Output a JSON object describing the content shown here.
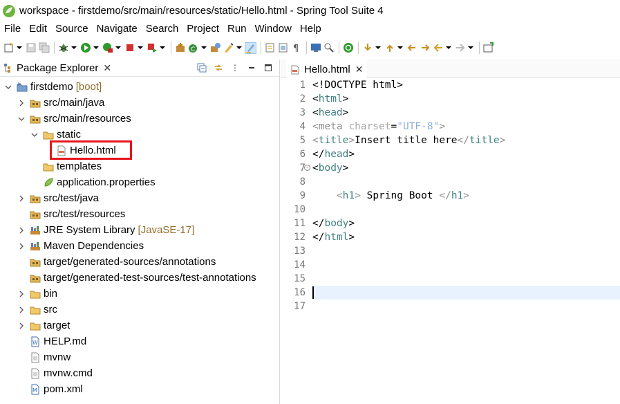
{
  "window": {
    "title": "workspace - firstdemo/src/main/resources/static/Hello.html - Spring Tool Suite 4"
  },
  "menu": [
    "File",
    "Edit",
    "Source",
    "Navigate",
    "Search",
    "Project",
    "Run",
    "Window",
    "Help"
  ],
  "package_explorer": {
    "tab_label": "Package Explorer",
    "tree": [
      {
        "label": "firstdemo",
        "deco": "[boot]",
        "icon": "project-icon",
        "expanded": true
      },
      {
        "label": "src/main/java",
        "icon": "source-folder-icon",
        "expanded": false
      },
      {
        "label": "src/main/resources",
        "icon": "source-folder-icon",
        "expanded": true
      },
      {
        "label": "static",
        "icon": "folder-icon",
        "expanded": true
      },
      {
        "label": "Hello.html",
        "icon": "html-file-icon",
        "highlighted": true
      },
      {
        "label": "templates",
        "icon": "folder-icon"
      },
      {
        "label": "application.properties",
        "icon": "properties-file-icon"
      },
      {
        "label": "src/test/java",
        "icon": "source-folder-icon",
        "expanded": false
      },
      {
        "label": "src/test/resources",
        "icon": "source-folder-icon"
      },
      {
        "label": "JRE System Library",
        "deco": "[JavaSE-17]",
        "icon": "library-icon",
        "expanded": false
      },
      {
        "label": "Maven Dependencies",
        "icon": "library-icon",
        "expanded": false
      },
      {
        "label": "target/generated-sources/annotations",
        "icon": "source-folder-icon"
      },
      {
        "label": "target/generated-test-sources/test-annotations",
        "icon": "source-folder-icon"
      },
      {
        "label": "bin",
        "icon": "folder-icon",
        "expanded": false
      },
      {
        "label": "src",
        "icon": "folder-icon",
        "expanded": false
      },
      {
        "label": "target",
        "icon": "folder-icon",
        "expanded": false
      },
      {
        "label": "HELP.md",
        "icon": "text-file-icon"
      },
      {
        "label": "mvnw",
        "icon": "file-icon"
      },
      {
        "label": "mvnw.cmd",
        "icon": "file-icon"
      },
      {
        "label": "pom.xml",
        "icon": "xml-file-icon"
      }
    ]
  },
  "editor": {
    "tab_label": "Hello.html",
    "current_line": 16,
    "lines": [
      [
        [
          "black",
          "<!DOCTYPE html>"
        ]
      ],
      [
        [
          "black",
          "<"
        ],
        [
          "tag",
          "html"
        ],
        [
          "black",
          ">"
        ]
      ],
      [
        [
          "black",
          "<"
        ],
        [
          "tag",
          "head"
        ],
        [
          "black",
          ">"
        ]
      ],
      [
        [
          "gray",
          "<"
        ],
        [
          "gray",
          "meta"
        ],
        [
          "attr",
          " charset"
        ],
        [
          "black",
          "="
        ],
        [
          "str",
          "\"UTF-8\""
        ],
        [
          "gray",
          ">"
        ]
      ],
      [
        [
          "gray",
          "<"
        ],
        [
          "tag",
          "title"
        ],
        [
          "gray",
          ">"
        ],
        [
          "black",
          "Insert title here"
        ],
        [
          "gray",
          "</"
        ],
        [
          "tag",
          "title"
        ],
        [
          "gray",
          ">"
        ]
      ],
      [
        [
          "black",
          "</"
        ],
        [
          "tag",
          "head"
        ],
        [
          "black",
          ">"
        ]
      ],
      [
        [
          "black",
          "<"
        ],
        [
          "tag",
          "body"
        ],
        [
          "black",
          ">"
        ]
      ],
      [],
      [
        [
          "black",
          "    "
        ],
        [
          "gray",
          "<"
        ],
        [
          "h1",
          "h1"
        ],
        [
          "gray",
          ">"
        ],
        [
          "black",
          " Spring Boot "
        ],
        [
          "gray",
          "</"
        ],
        [
          "h1",
          "h1"
        ],
        [
          "gray",
          ">"
        ]
      ],
      [],
      [
        [
          "black",
          "</"
        ],
        [
          "tag",
          "body"
        ],
        [
          "black",
          ">"
        ]
      ],
      [
        [
          "black",
          "</"
        ],
        [
          "tag",
          "html"
        ],
        [
          "black",
          ">"
        ]
      ],
      [],
      [],
      [],
      [],
      []
    ]
  },
  "colors": {
    "highlight_box": "#e8141c",
    "current_line": "#e8f2fe",
    "tag": "#3f7f7f",
    "deco": "#956d2b"
  }
}
